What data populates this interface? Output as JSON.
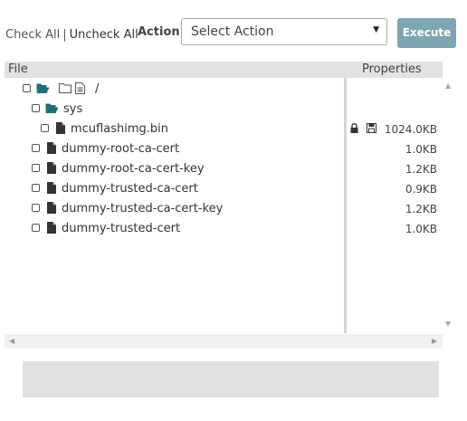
{
  "toolbar": {
    "check_all": "Check All",
    "separator": "|",
    "uncheck_all": "Uncheck All",
    "action_label": "Action:",
    "action_selected": "Select Action",
    "execute": "Execute"
  },
  "columns": {
    "file": "File",
    "properties": "Properties"
  },
  "tree": [
    {
      "name": "/",
      "type": "root",
      "size": ""
    },
    {
      "name": "sys",
      "type": "folder",
      "size": ""
    },
    {
      "name": "mcuflashimg.bin",
      "type": "file",
      "size": "1024.0KB",
      "locked": true,
      "disk": true
    },
    {
      "name": "dummy-root-ca-cert",
      "type": "file",
      "size": "1.0KB"
    },
    {
      "name": "dummy-root-ca-cert-key",
      "type": "file",
      "size": "1.2KB"
    },
    {
      "name": "dummy-trusted-ca-cert",
      "type": "file",
      "size": "0.9KB"
    },
    {
      "name": "dummy-trusted-ca-cert-key",
      "type": "file",
      "size": "1.2KB"
    },
    {
      "name": "dummy-trusted-cert",
      "type": "file",
      "size": "1.0KB"
    }
  ],
  "icons": {
    "folder_open": "folder-open-icon",
    "folder": "folder-icon",
    "document": "document-icon",
    "file": "file-icon",
    "lock": "lock-icon",
    "disk": "save-disk-icon"
  },
  "colors": {
    "folder": "#1e6e78",
    "execute_bg": "#7ea6b0",
    "header_bg": "#e2e2e2"
  }
}
